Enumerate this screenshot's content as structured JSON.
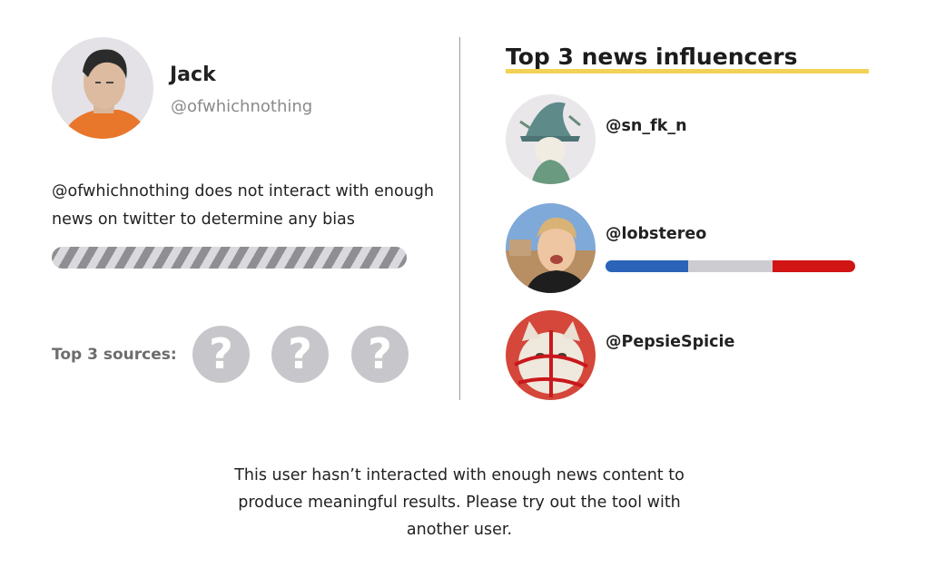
{
  "user": {
    "name": "Jack",
    "handle": "@ofwhichnothing",
    "message": "@ofwhichnothing does not interact with enough news on twitter to determine any bias"
  },
  "sources": {
    "label": "Top 3 sources:",
    "slots": [
      "?",
      "?",
      "?"
    ]
  },
  "influencers": {
    "title": "Top 3 news influencers",
    "items": [
      {
        "handle": "@sn_fk_n"
      },
      {
        "handle": "@lobstereo",
        "bias": [
          {
            "color": "#2a63b8",
            "share": 0.33
          },
          {
            "color": "#cdccd1",
            "share": 0.34
          },
          {
            "color": "#d11414",
            "share": 0.33
          }
        ]
      },
      {
        "handle": "@PepsieSpicie"
      }
    ]
  },
  "footer": {
    "message": "This user hasn’t interacted with enough news content to produce meaningful results. Please try out the tool with another user."
  },
  "colors": {
    "accent_underline": "#f2d155",
    "placeholder_gray": "#c7c7cb"
  }
}
